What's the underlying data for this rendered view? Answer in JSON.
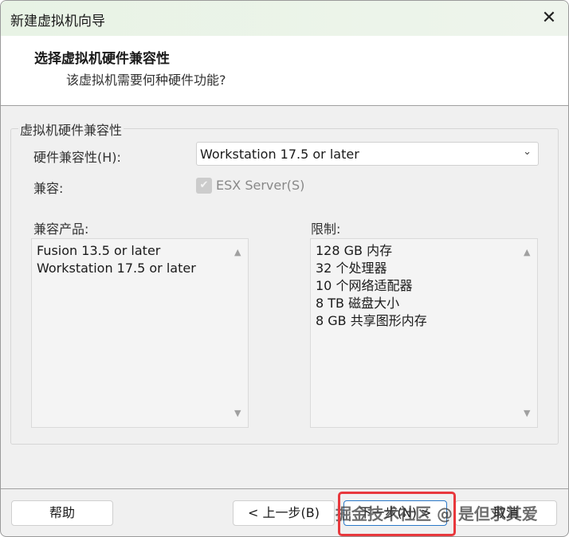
{
  "window": {
    "title": "新建虚拟机向导",
    "close": "✕"
  },
  "header": {
    "title": "选择虚拟机硬件兼容性",
    "subtitle": "该虚拟机需要何种硬件功能?"
  },
  "group": {
    "legend": "虚拟机硬件兼容性",
    "hw_label": "硬件兼容性(H):",
    "hw_value": "Workstation 17.5 or later",
    "compat_label": "兼容:",
    "esx_label": "ESX Server(S)",
    "esx_checked": true,
    "products_label": "兼容产品:",
    "products": [
      "Fusion 13.5 or later",
      "Workstation 17.5 or later"
    ],
    "limits_label": "限制:",
    "limits": [
      "128 GB 内存",
      "32 个处理器",
      "10 个网络适配器",
      "8 TB 磁盘大小",
      "8 GB 共享图形内存"
    ]
  },
  "buttons": {
    "help": "帮助",
    "back": "< 上一步(B)",
    "next": "下一步(N) >",
    "cancel": "取消"
  },
  "watermark": "掘金技术社区 @ 是但求其爱",
  "colors": {
    "accent": "#2a78c8",
    "annotation": "#e8383d"
  }
}
